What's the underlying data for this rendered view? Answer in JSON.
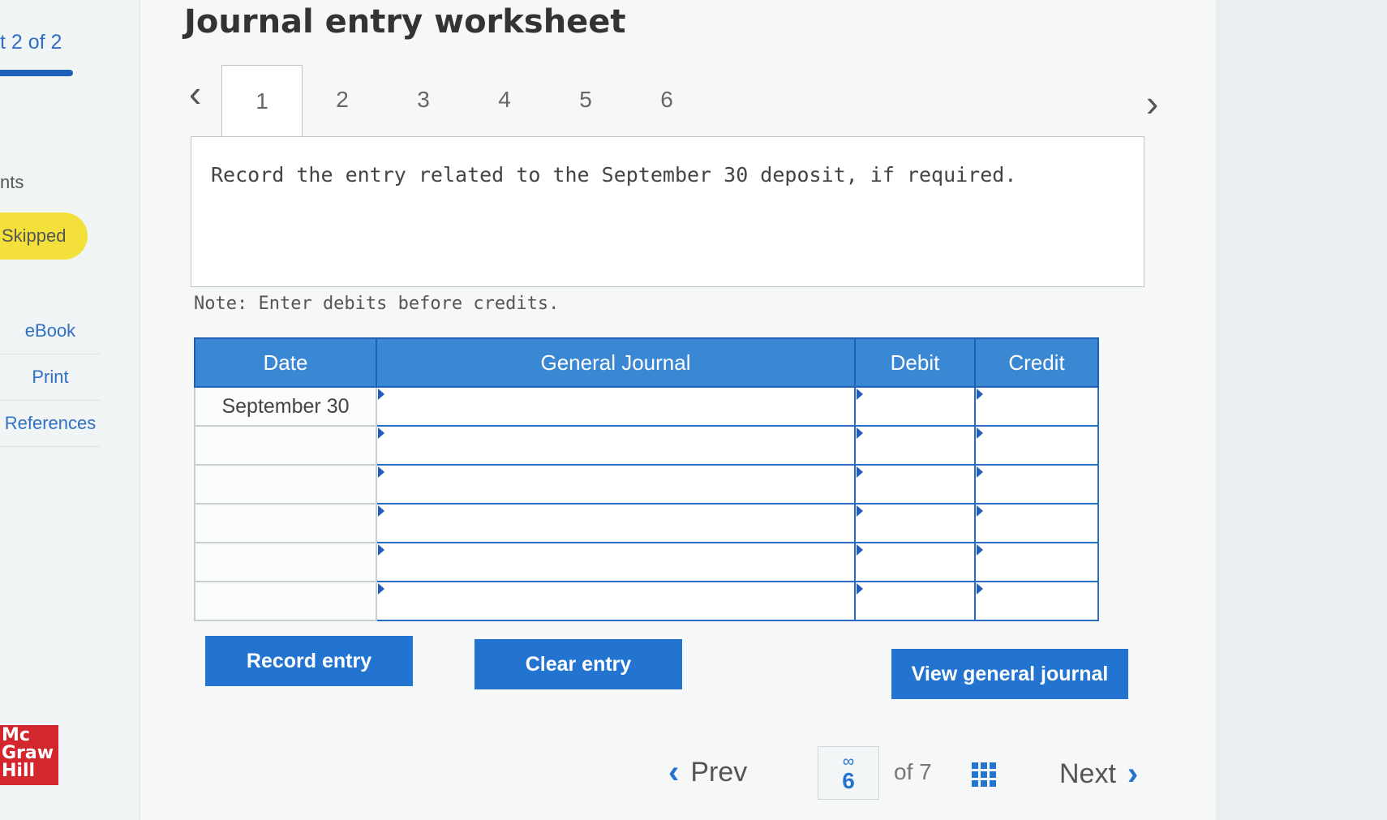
{
  "sidebar": {
    "part_label": "t 2 of 2",
    "points_label": "nts",
    "status_badge": "Skipped",
    "links": [
      "eBook",
      "Print",
      "References"
    ],
    "logo_text": [
      "Mc",
      "Graw",
      "Hill"
    ]
  },
  "header": {
    "title": "Journal entry worksheet"
  },
  "tabs": [
    "1",
    "2",
    "3",
    "4",
    "5",
    "6"
  ],
  "active_tab": "1",
  "prompt": "Record the entry related to the September 30 deposit, if required.",
  "note": "Note: Enter debits before credits.",
  "journal_table": {
    "headers": [
      "Date",
      "General Journal",
      "Debit",
      "Credit"
    ],
    "rows": [
      {
        "date": "September 30",
        "account": "",
        "debit": "",
        "credit": ""
      },
      {
        "date": "",
        "account": "",
        "debit": "",
        "credit": ""
      },
      {
        "date": "",
        "account": "",
        "debit": "",
        "credit": ""
      },
      {
        "date": "",
        "account": "",
        "debit": "",
        "credit": ""
      },
      {
        "date": "",
        "account": "",
        "debit": "",
        "credit": ""
      },
      {
        "date": "",
        "account": "",
        "debit": "",
        "credit": ""
      }
    ]
  },
  "buttons": {
    "record": "Record entry",
    "clear": "Clear entry",
    "view": "View general journal"
  },
  "footer": {
    "prev": "Prev",
    "current_page": "6",
    "of_total": "of 7",
    "next": "Next"
  },
  "colors": {
    "accent": "#2274d0",
    "header_blue": "#3a87d4",
    "badge_yellow": "#f4e03a",
    "logo_red": "#d3272e"
  }
}
